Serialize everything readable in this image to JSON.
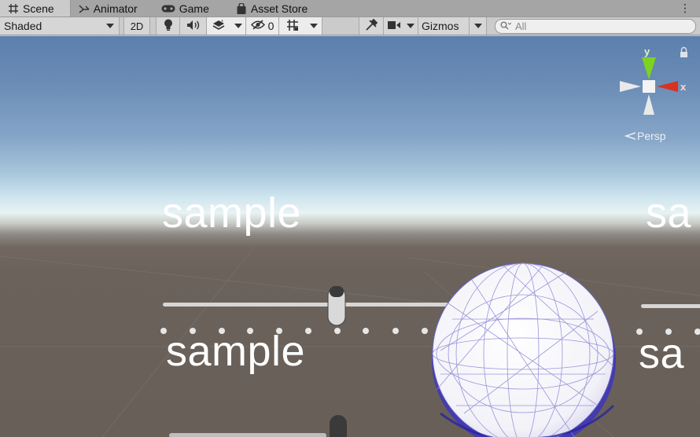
{
  "tabs": [
    {
      "label": "Scene",
      "icon": "grid-icon",
      "active": true
    },
    {
      "label": "Animator",
      "icon": "animator-icon",
      "active": false
    },
    {
      "label": "Game",
      "icon": "gamepad-icon",
      "active": false
    },
    {
      "label": "Asset Store",
      "icon": "shopping-bag-icon",
      "active": false
    }
  ],
  "toolbar": {
    "draw_mode": "Shaded",
    "mode_2d": "2D",
    "hidden_count": "0",
    "gizmos": "Gizmos"
  },
  "search": {
    "placeholder": "All"
  },
  "gizmo": {
    "y_label": "y",
    "x_label": "x",
    "projection": "Persp"
  },
  "scene": {
    "texts": [
      "sample",
      "sample",
      "sa",
      "sa"
    ],
    "colors": {
      "sky_top": "#5c7fad",
      "horizon": "#e8f2f3",
      "ground": "#675f58",
      "x_axis": "#d9321f",
      "y_axis": "#7ed321",
      "sphere_wire": "#3b32c4"
    }
  }
}
